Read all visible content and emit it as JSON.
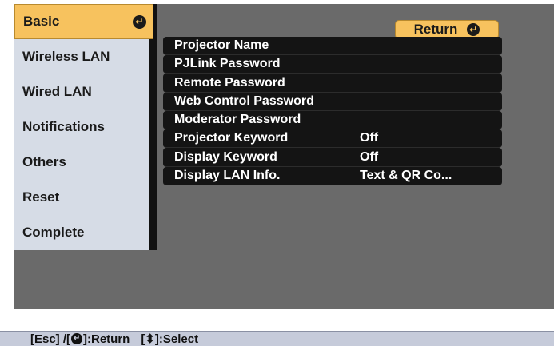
{
  "sidebar": {
    "items": [
      {
        "label": "Basic",
        "active": true
      },
      {
        "label": "Wireless LAN"
      },
      {
        "label": "Wired LAN"
      },
      {
        "label": "Notifications"
      },
      {
        "label": "Others"
      },
      {
        "label": "Reset"
      },
      {
        "label": "Complete"
      }
    ],
    "enter_icon": "enter-icon"
  },
  "panel": {
    "return_label": "Return",
    "rows": [
      {
        "label": "Projector Name",
        "value": ""
      },
      {
        "label": "PJLink Password",
        "value": ""
      },
      {
        "label": "Remote Password",
        "value": ""
      },
      {
        "label": "Web Control Password",
        "value": ""
      },
      {
        "label": "Moderator Password",
        "value": ""
      },
      {
        "label": "Projector Keyword",
        "value": "Off"
      },
      {
        "label": "Display Keyword",
        "value": "Off"
      },
      {
        "label": "Display LAN Info.",
        "value": "Text & QR Co..."
      }
    ]
  },
  "helpbar": {
    "esc": "[Esc] /[",
    "return_text": "]:Return",
    "select_open": "[",
    "select_text": "]:Select"
  },
  "colors": {
    "accent": "#f7c25e",
    "sidebar_bg": "#d6dce6",
    "panel_bg": "#6a6a6a",
    "row_bg": "#141414",
    "helpbar_bg": "#c6cbda"
  }
}
